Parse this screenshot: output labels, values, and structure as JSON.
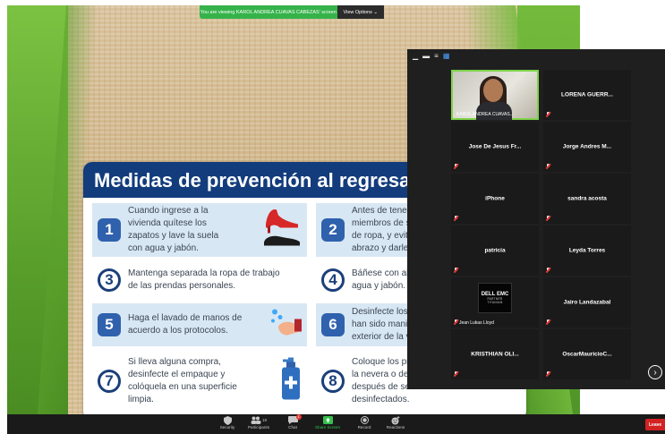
{
  "share_banner": {
    "text": "You are viewing KAROL ANDREA CUAVAS CABEZAS' screen",
    "view_options": "View Options ⌄"
  },
  "infographic": {
    "title": "Medidas de prevención al regresar a la",
    "steps": [
      {
        "number": "1",
        "text": "Cuando ingrese a la\nvivienda quítese los\nzapatos y lave la suela\ncon agua y jabón."
      },
      {
        "number": "2",
        "text": "Antes de tener\nmiembros de s\nde ropa, y evite\nabrazo y darle"
      },
      {
        "number": "3",
        "text": "Mantenga separada la ropa de trabajo\nde las prendas personales."
      },
      {
        "number": "4",
        "text": "Báñese con ab\nagua y jabón."
      },
      {
        "number": "5",
        "text": "Haga el lavado de manos de\nacuerdo a los protocolos."
      },
      {
        "number": "6",
        "text": "Desinfecte los\nhan sido mani\nexterior de la v"
      },
      {
        "number": "7",
        "text": "Si lleva alguna compra,\ndesinfecte el empaque y\ncolóquela en una superficie\nlimpia."
      },
      {
        "number": "8",
        "text": "Coloque los pr\nla nevera o de\ndespués de se\ndesinfectados."
      }
    ]
  },
  "gallery": {
    "self_label": "KAROL ANDREA CUAVAS...",
    "participants": [
      "LORENA GUERR...",
      "Jose De Jesus Fr...",
      "Jorge Andres M...",
      "iPhone",
      "sandra acosta",
      "patricia",
      "Leyda Torres",
      "Jairo Landazabal",
      "KRISTHIAN OLI...",
      "OscarMauricioC..."
    ],
    "dell_tile": {
      "label": "Jean Lukas Lloyd",
      "logo_line1": "DELL EMC",
      "logo_line2": "PARTNER",
      "logo_line3": "TITANIUM"
    }
  },
  "toolbar": {
    "security": "Security",
    "participants": "Participants",
    "participants_count": "19",
    "chat": "Chat",
    "chat_badge": "1",
    "share_screen": "Share Screen",
    "record": "Record",
    "reactions": "Reactions",
    "leave": "Leave"
  },
  "colors": {
    "title_bar": "#123c7c",
    "number_solid": "#2f61ad",
    "number_ring": "#1b3f7a",
    "step_tint": "#d8e7f4",
    "zoom_green": "#35b34a",
    "leave_red": "#d32222"
  },
  "icons": {
    "step1": "shoe-icon",
    "step5": "handwash-icon",
    "step7": "sanitizer-bottle-icon"
  }
}
